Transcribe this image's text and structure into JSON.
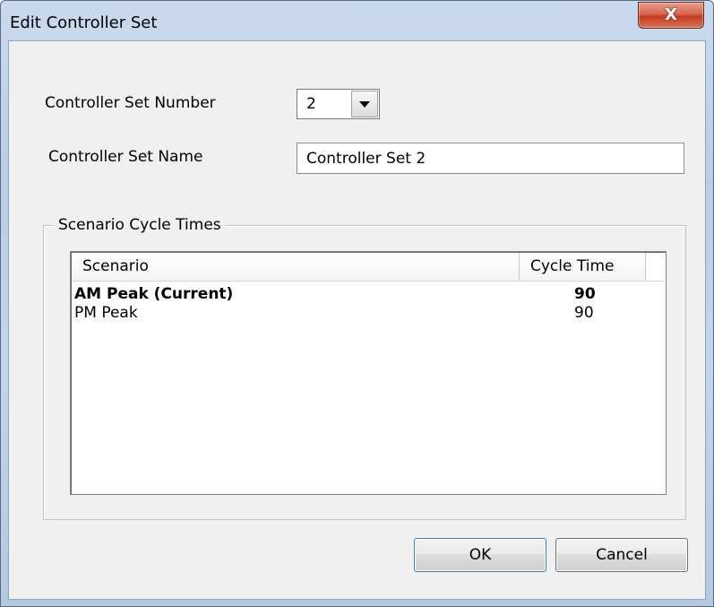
{
  "window": {
    "title": "Edit Controller Set",
    "close_glyph": "X"
  },
  "form": {
    "number_label": "Controller Set Number",
    "number_value": "2",
    "name_label": "Controller Set Name",
    "name_value": "Controller Set 2"
  },
  "group": {
    "title": "Scenario Cycle Times",
    "columns": [
      "Scenario",
      "Cycle Time"
    ],
    "rows": [
      {
        "scenario": "AM Peak (Current)",
        "cycle_time": "90",
        "bold": true
      },
      {
        "scenario": "PM Peak",
        "cycle_time": "90",
        "bold": false
      }
    ]
  },
  "buttons": {
    "ok": "OK",
    "cancel": "Cancel"
  },
  "icons": {
    "combo_arrow": "chevron-down-icon",
    "close": "close-icon"
  }
}
